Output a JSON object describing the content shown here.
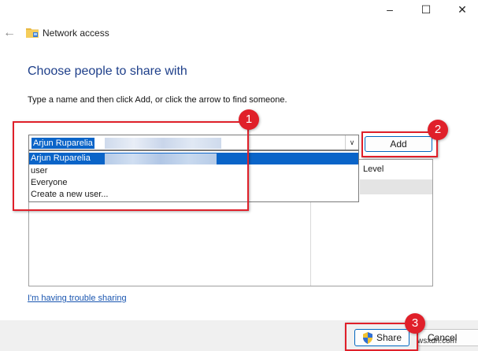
{
  "window": {
    "controls": [
      "–",
      "☐",
      "✕"
    ],
    "title": "Network access"
  },
  "heading": "Choose people to share with",
  "instructions": "Type a name and then click Add, or click the arrow to find someone.",
  "combo": {
    "value": "Arjun Ruparelia"
  },
  "dropdown": {
    "options": [
      "Arjun Ruparelia",
      "user",
      "Everyone",
      "Create a new user..."
    ],
    "selected_index": 0
  },
  "buttons": {
    "add": "Add",
    "share": "Share",
    "cancel": "Cancel"
  },
  "permissions": {
    "column_header": "Level"
  },
  "link": {
    "trouble": "I'm having trouble sharing"
  },
  "callouts": [
    "1",
    "2",
    "3"
  ],
  "watermark": "wsxdn.com",
  "colors": {
    "accent": "#0a64c8",
    "callout": "#e0202a",
    "heading": "#1e3f8a",
    "link": "#1a56b0"
  },
  "icons": {
    "back": "back-arrow-icon",
    "folder": "network-folder-icon",
    "shield": "uac-shield-icon",
    "dropdown": "chevron-down-icon"
  }
}
